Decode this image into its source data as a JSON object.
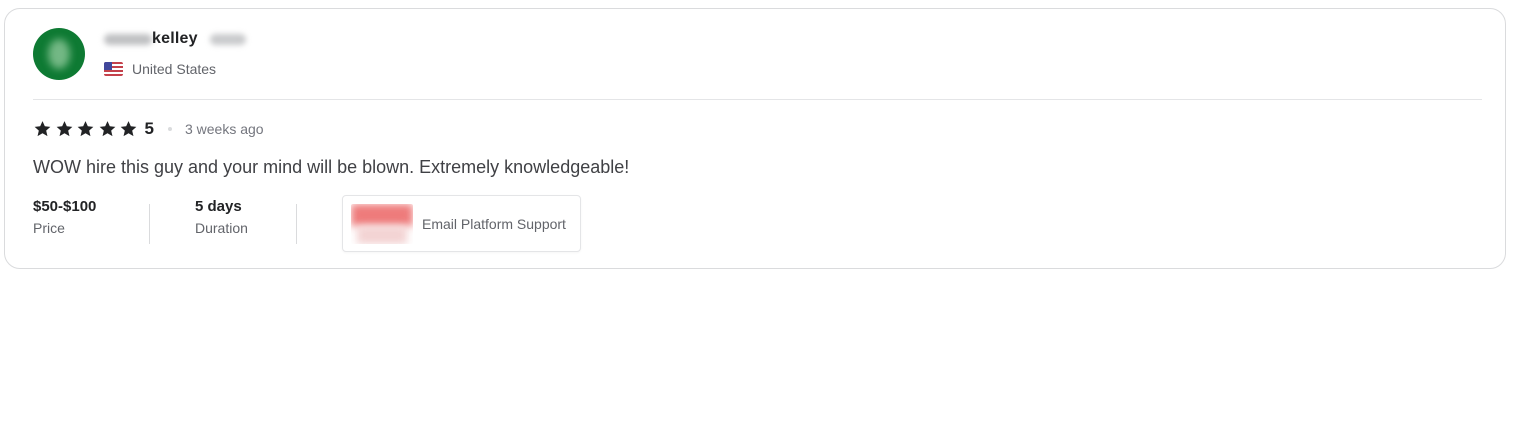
{
  "review": {
    "reviewer": {
      "name": "kelley",
      "country": "United States",
      "avatar_color": "#0e7a33"
    },
    "rating": {
      "value": "5",
      "stars_filled": 5,
      "stars_total": 5,
      "star_color": "#222325"
    },
    "time_ago": "3 weeks ago",
    "text": "WOW hire this guy and your mind will be blown. Extremely knowledgeable!",
    "price": {
      "value": "$50-$100",
      "label": "Price"
    },
    "duration": {
      "value": "5 days",
      "label": "Duration"
    },
    "gig": {
      "title": "Email Platform Support",
      "thumbnail_color": "#ee7b7b"
    }
  },
  "icons": {
    "star": "star-icon",
    "flag": "us-flag-icon"
  }
}
